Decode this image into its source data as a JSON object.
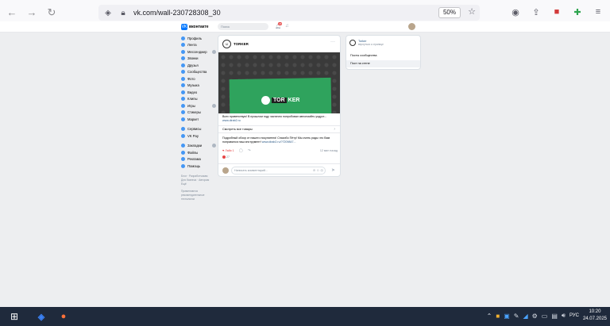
{
  "browser": {
    "url": "vk.com/wall-230728308_30",
    "zoom": "50%"
  },
  "vk_header": {
    "logo_text": "вконтакте",
    "search_placeholder": "Поиск",
    "notifications_count": "18"
  },
  "left_menu": {
    "items": [
      {
        "label": "Профиль",
        "icon": "user-icon"
      },
      {
        "label": "Лента",
        "icon": "news-icon"
      },
      {
        "label": "Мессенджер",
        "icon": "message-icon",
        "badge": true
      },
      {
        "label": "Звонки",
        "icon": "phone-icon"
      },
      {
        "label": "Друзья",
        "icon": "friends-icon"
      },
      {
        "label": "Сообщества",
        "icon": "groups-icon"
      },
      {
        "label": "Фото",
        "icon": "photo-icon"
      },
      {
        "label": "Музыка",
        "icon": "music-icon"
      },
      {
        "label": "Видео",
        "icon": "video-icon"
      },
      {
        "label": "Клипы",
        "icon": "clips-icon"
      },
      {
        "label": "Игры",
        "icon": "games-icon",
        "badge": true
      },
      {
        "label": "Стикеры",
        "icon": "stickers-icon"
      },
      {
        "label": "Маркет",
        "icon": "market-icon"
      }
    ],
    "items2": [
      {
        "label": "Сервисы",
        "icon": "services-icon"
      },
      {
        "label": "VK Pay",
        "icon": "vkpay-icon"
      }
    ],
    "items3": [
      {
        "label": "Закладки",
        "icon": "bookmark-icon",
        "badge": true
      },
      {
        "label": "Файлы",
        "icon": "files-icon"
      },
      {
        "label": "Реклама",
        "icon": "ads-icon"
      },
      {
        "label": "Помощь",
        "icon": "help-icon"
      }
    ],
    "footer_line1": "Блог · Разработчикам",
    "footer_line2": "Для бизнеса · Авторам",
    "footer_line3": "Ещё",
    "footer_line4": "Применяются",
    "footer_line5": "рекомендательные",
    "footer_line6": "технологии"
  },
  "post": {
    "author": "TORKER",
    "image_logo_left": "TOR",
    "image_logo_right": "KER",
    "text": "Всех приветствую! В прошлом году частично попробовал автоломйть уодуст...",
    "text_link": "www.dirab2.ru",
    "goods_label": "Смотреть все товары",
    "review_text": "Подробный обзор от нашего покупателя! Спасибо Пётр! Мы очень рады что Вам понравился наш инструмент! ",
    "review_link": "www.dirab2.ru/?7209847...",
    "like_label": "Лайк",
    "like_count": "1",
    "comment_count": "",
    "time": "12 мин назад",
    "likes_total": "27",
    "comment_placeholder": "Написать комментарий..."
  },
  "right_panel": {
    "group_name": "Torker",
    "group_sub": "вернуться к странице",
    "tab1": "Посты сообщества",
    "tab2": "Пост на стене"
  },
  "taskbar": {
    "time": "10:20",
    "date": "24.07.2025",
    "lang": "РУС"
  }
}
